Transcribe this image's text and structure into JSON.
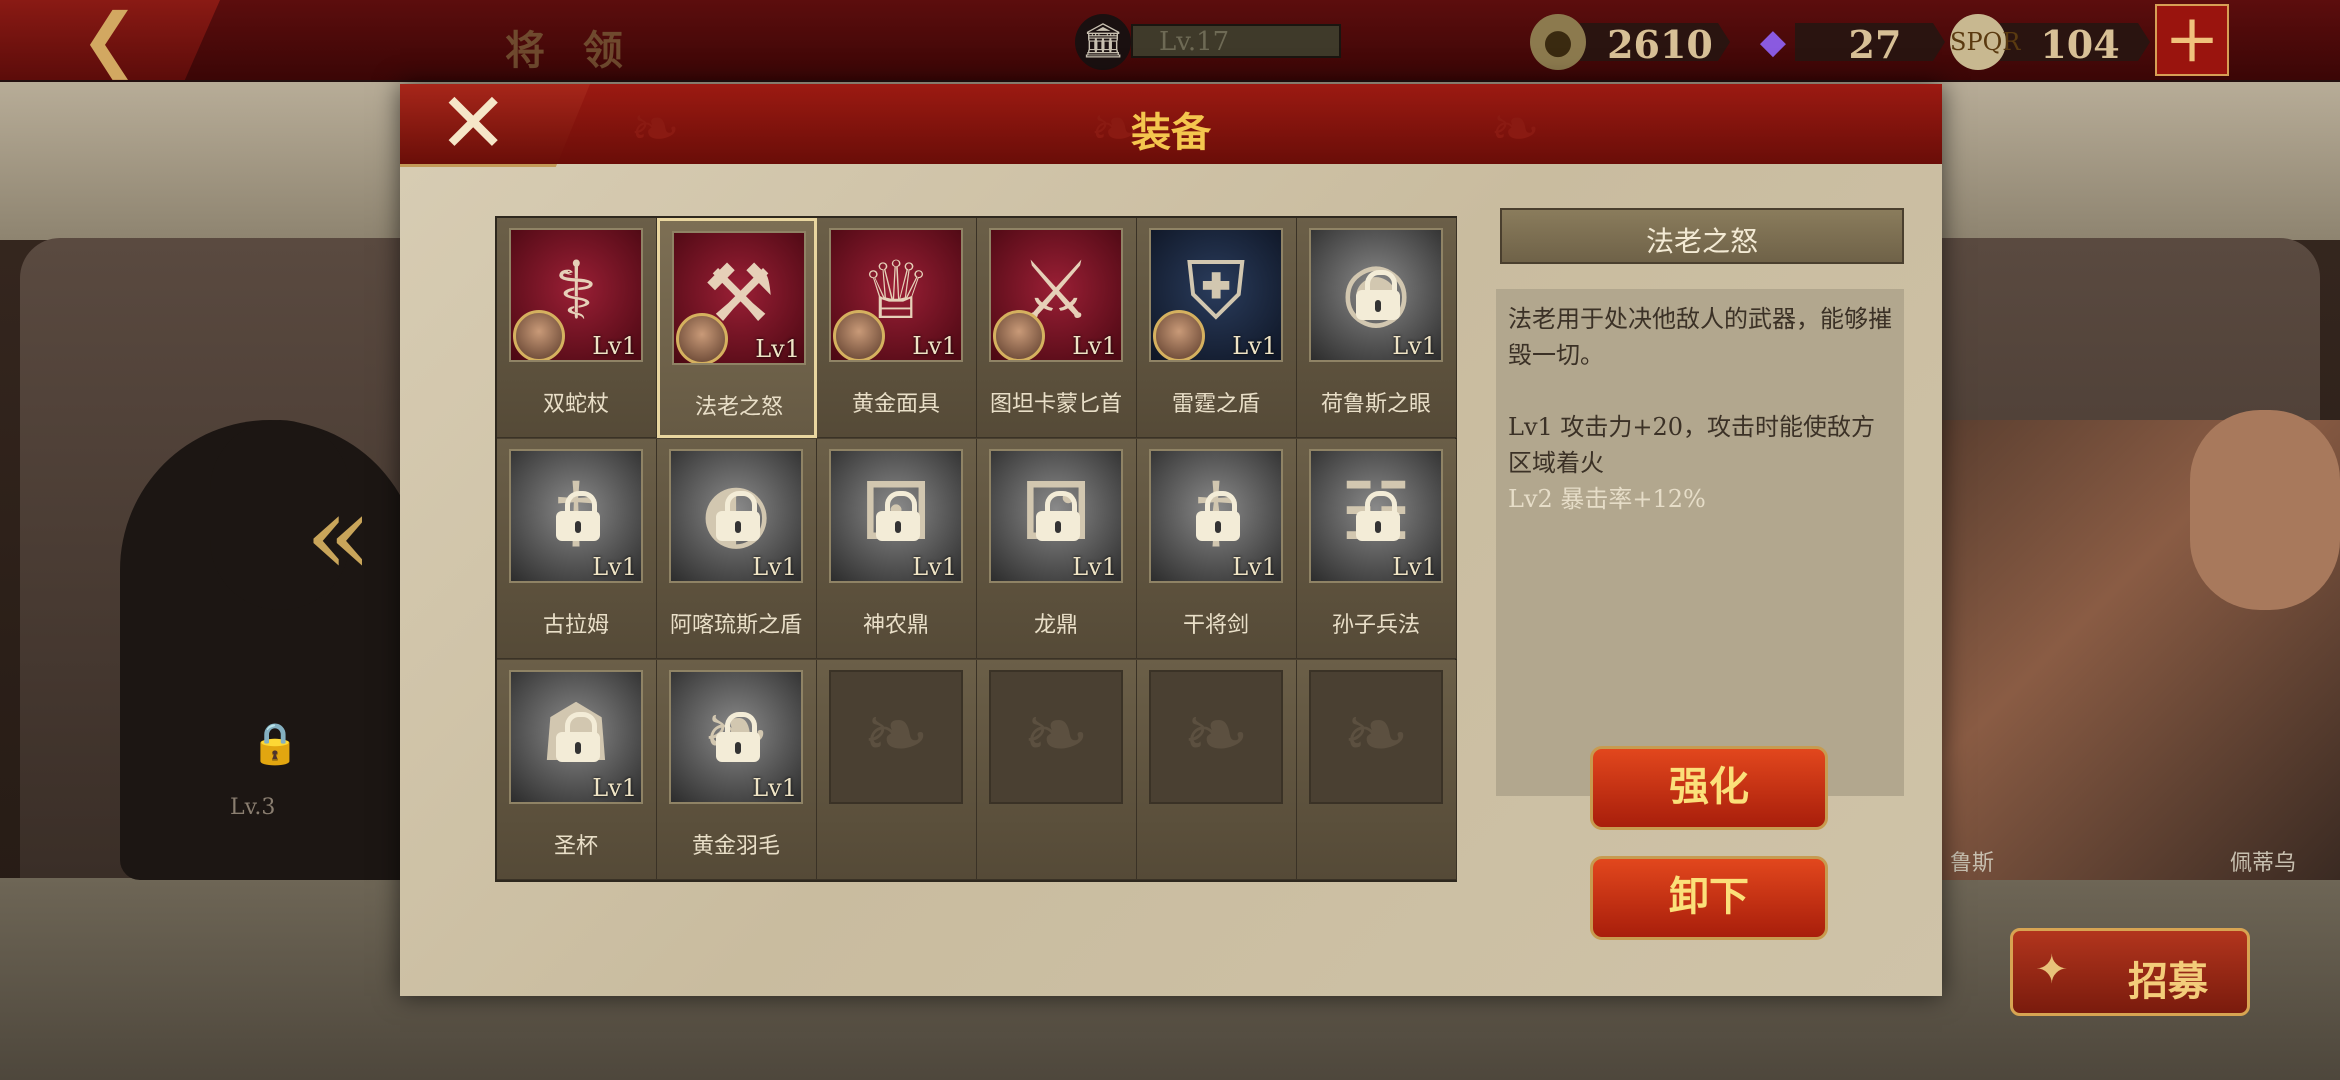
{
  "topbar": {
    "title": "将 领",
    "level": "Lv.17",
    "gold": "2610",
    "gems": "27",
    "tickets": "104",
    "ticket_icon_text": "SPQR"
  },
  "background": {
    "locked_hero_level": "Lv.3",
    "hero_name_1": "鲁斯",
    "hero_name_2": "佩蒂乌",
    "recruit_label": "招募"
  },
  "dialog": {
    "title": "装备",
    "items": [
      {
        "name": "双蛇杖",
        "level": "Lv1",
        "bg": "red",
        "icon": "caduceus-icon",
        "locked": false,
        "hero": true
      },
      {
        "name": "法老之怒",
        "level": "Lv1",
        "bg": "red",
        "icon": "axe-icon",
        "locked": false,
        "hero": true,
        "selected": true
      },
      {
        "name": "黄金面具",
        "level": "Lv1",
        "bg": "red",
        "icon": "pharaoh-mask-icon",
        "locked": false,
        "hero": true
      },
      {
        "name": "图坦卡蒙匕首",
        "level": "Lv1",
        "bg": "red",
        "icon": "dagger-icon",
        "locked": false,
        "hero": true
      },
      {
        "name": "雷霆之盾",
        "level": "Lv1",
        "bg": "navy",
        "icon": "shield-icon",
        "locked": false,
        "hero": true
      },
      {
        "name": "荷鲁斯之眼",
        "level": "Lv1",
        "bg": "grey",
        "icon": "eye-of-horus-icon",
        "locked": true,
        "hero": false
      },
      {
        "name": "古拉姆",
        "level": "Lv1",
        "bg": "grey",
        "icon": "sword-icon",
        "locked": true,
        "hero": false
      },
      {
        "name": "阿喀琉斯之盾",
        "level": "Lv1",
        "bg": "grey",
        "icon": "round-shield-icon",
        "locked": true,
        "hero": false
      },
      {
        "name": "神农鼎",
        "level": "Lv1",
        "bg": "grey",
        "icon": "cauldron-icon",
        "locked": true,
        "hero": false
      },
      {
        "name": "龙鼎",
        "level": "Lv1",
        "bg": "grey",
        "icon": "dragon-cauldron-icon",
        "locked": true,
        "hero": false
      },
      {
        "name": "干将剑",
        "level": "Lv1",
        "bg": "grey",
        "icon": "short-sword-icon",
        "locked": true,
        "hero": false
      },
      {
        "name": "孙子兵法",
        "level": "Lv1",
        "bg": "grey",
        "icon": "scroll-icon",
        "locked": true,
        "hero": false
      },
      {
        "name": "圣杯",
        "level": "Lv1",
        "bg": "grey",
        "icon": "grail-icon",
        "locked": true,
        "hero": false
      },
      {
        "name": "黄金羽毛",
        "level": "Lv1",
        "bg": "grey",
        "icon": "feather-wing-icon",
        "locked": true,
        "hero": false
      },
      {
        "empty": true
      },
      {
        "empty": true
      },
      {
        "empty": true
      },
      {
        "empty": true
      }
    ],
    "detail": {
      "title": "法老之怒",
      "description": "法老用于处决他敌人的武器，能够摧毁一切。",
      "lv1": "Lv1  攻击力+20，攻击时能使敌方区域着火",
      "lv2": "Lv2  暴击率+12%"
    },
    "upgrade_label": "强化",
    "unequip_label": "卸下"
  },
  "colors": {
    "header_red": "#9c1a12",
    "gold_text": "#f4c64e",
    "button_red": "#e2471d"
  }
}
